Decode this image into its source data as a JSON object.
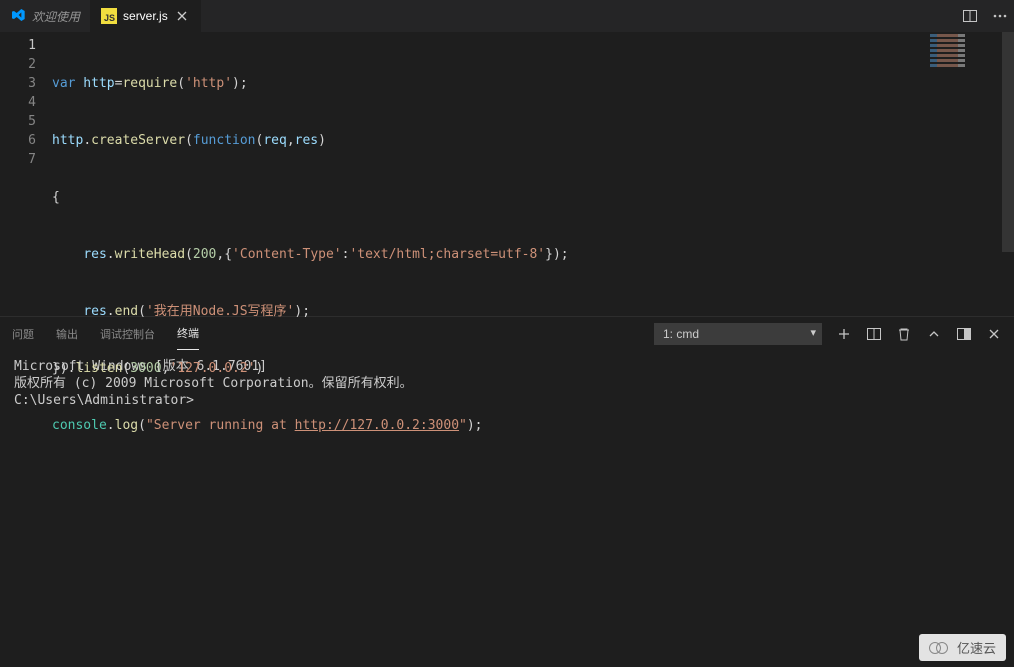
{
  "tabs": {
    "welcome": "欢迎使用",
    "active_file": "server.js",
    "active_file_icon": "JS"
  },
  "line_numbers": [
    "1",
    "2",
    "3",
    "4",
    "5",
    "6",
    "7"
  ],
  "code": {
    "l1": {
      "kw": "var",
      "var": " http",
      "plain1": "=",
      "fn": "require",
      "plain2": "(",
      "str": "'http'",
      "plain3": ");"
    },
    "l2": {
      "var1": "http",
      "plain1": ".",
      "fn": "createServer",
      "plain2": "(",
      "kw": "function",
      "plain3": "(",
      "var2": "req",
      "plain4": ",",
      "var3": "res",
      "plain5": ")"
    },
    "l3": {
      "plain": "{"
    },
    "l4": {
      "indent": "    ",
      "var": "res",
      "plain1": ".",
      "fn": "writeHead",
      "plain2": "(",
      "num": "200",
      "plain3": ",{",
      "key": "'Content-Type'",
      "plain4": ":",
      "val": "'text/html;charset=utf-8'",
      "plain5": "});"
    },
    "l5": {
      "indent": "    ",
      "var": "res",
      "plain1": ".",
      "fn": "end",
      "plain2": "(",
      "str": "'我在用Node.JS写程序'",
      "plain3": ");"
    },
    "l6": {
      "plain1": "}).",
      "fn": "listen",
      "plain2": "(",
      "num": "3000",
      "plain3": ",",
      "str": "'127.0.0.2'",
      "plain4": ")"
    },
    "l7": {
      "obj": "console",
      "plain1": ".",
      "fn": "log",
      "plain2": "(",
      "str1": "\"Server running at ",
      "url": "http://127.0.0.2:3000",
      "str2": "\"",
      "plain3": ");"
    }
  },
  "panel": {
    "tab_problems": "问题",
    "tab_output": "输出",
    "tab_debug": "调试控制台",
    "tab_terminal": "终端",
    "terminal_selector": "1: cmd"
  },
  "terminal": {
    "line1": "Microsoft Windows [版本 6.1.7601]",
    "line2": "版权所有 (c) 2009 Microsoft Corporation。保留所有权利。",
    "blank": "",
    "prompt": "C:\\Users\\Administrator>"
  },
  "watermark": "亿速云"
}
